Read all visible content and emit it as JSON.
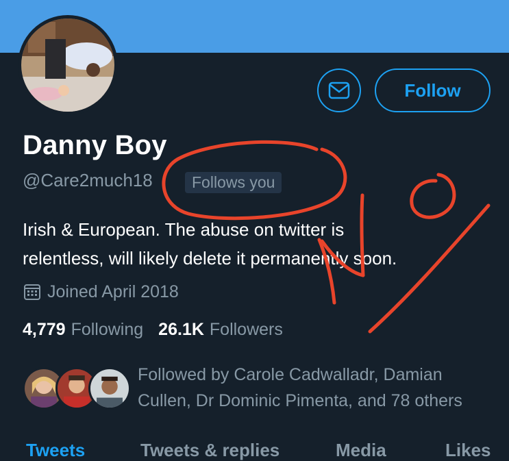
{
  "header": {
    "banner_color": "#4a9de6"
  },
  "actions": {
    "message_icon": "envelope-icon",
    "follow_label": "Follow"
  },
  "profile": {
    "name": "Danny Boy",
    "handle": "@Care2much18",
    "follows_you": "Follows you",
    "bio_line1": "Irish & European. The abuse on twitter is",
    "bio_line2": "relentless, will likely delete it permanently soon.",
    "joined": "Joined April 2018",
    "following_count": "4,779",
    "following_label": "Following",
    "followers_count": "26.1K",
    "followers_label": "Followers",
    "followed_by_line1": "Followed by Carole Cadwalladr, Damian",
    "followed_by_line2": "Cullen, Dr Dominic Pimenta, and 78 others"
  },
  "tabs": [
    "Tweets",
    "Tweets & replies",
    "Media",
    "Likes"
  ],
  "colors": {
    "background": "#15202b",
    "accent": "#1da1f2",
    "muted": "#8899a6",
    "annotation": "#e8442b"
  }
}
